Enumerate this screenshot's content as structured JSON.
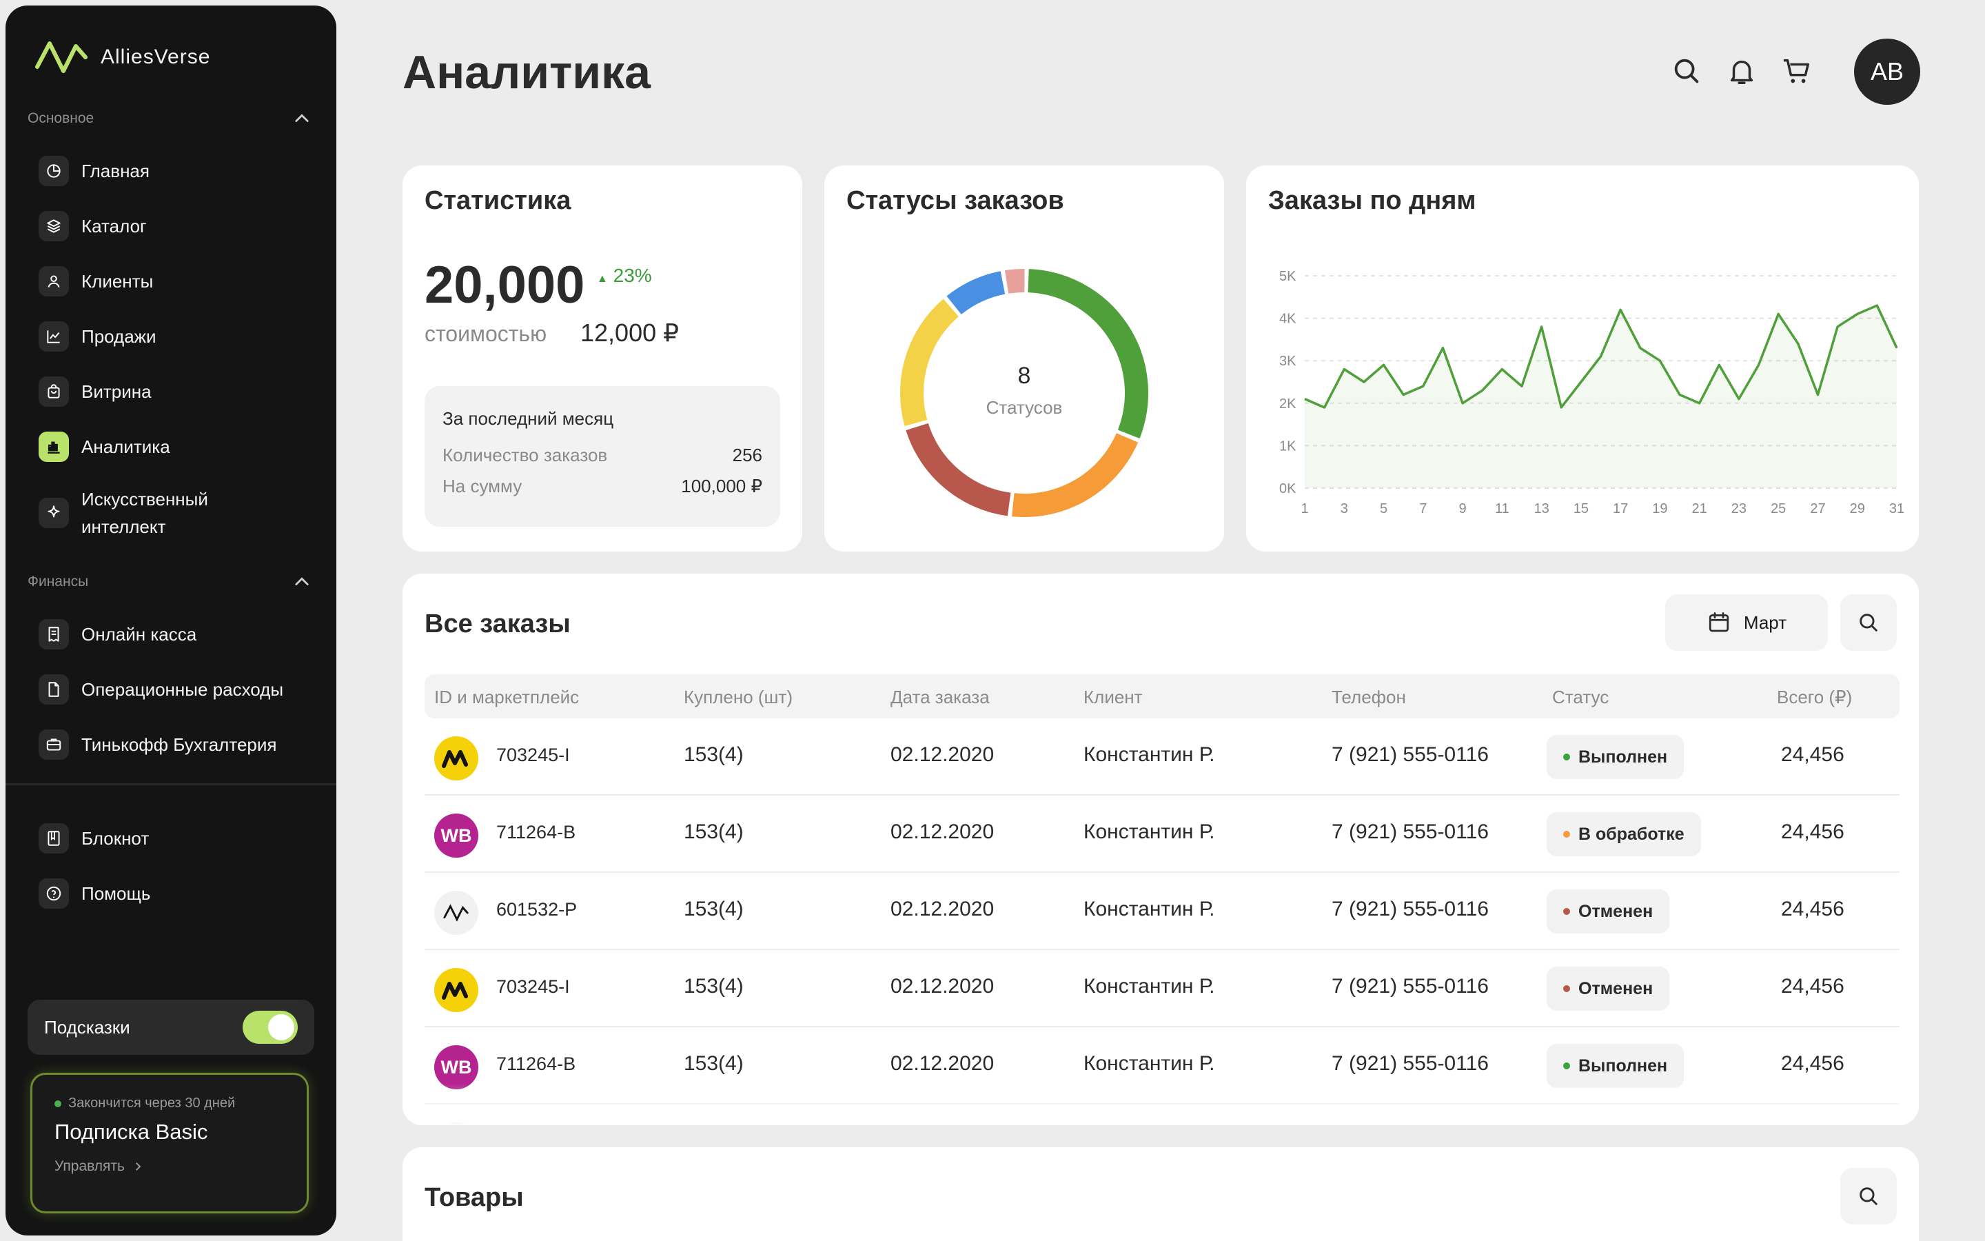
{
  "app": {
    "name": "AlliesVerse"
  },
  "header": {
    "title": "Аналитика",
    "avatar_initials": "AB"
  },
  "sidebar": {
    "section_main": "Основное",
    "section_finance": "Финансы",
    "items_main": [
      {
        "label": "Главная",
        "icon": "chart-pie-icon"
      },
      {
        "label": "Каталог",
        "icon": "layers-icon"
      },
      {
        "label": "Клиенты",
        "icon": "user-icon"
      },
      {
        "label": "Продажи",
        "icon": "line-chart-icon"
      },
      {
        "label": "Витрина",
        "icon": "bag-icon"
      },
      {
        "label": "Аналитика",
        "icon": "bar-chart-icon",
        "active": true
      },
      {
        "label": "Искусственный интеллект",
        "icon": "sparkle-icon"
      }
    ],
    "items_finance": [
      {
        "label": "Онлайн касса",
        "icon": "receipt-icon"
      },
      {
        "label": "Операционные расходы",
        "icon": "document-icon"
      },
      {
        "label": "Тинькофф Бухгалтерия",
        "icon": "briefcase-icon"
      }
    ],
    "items_bottom": [
      {
        "label": "Блокнот",
        "icon": "notebook-icon"
      },
      {
        "label": "Помощь",
        "icon": "help-icon"
      }
    ],
    "tips_label": "Подсказки",
    "tips_on": true,
    "subscription": {
      "note": "Закончится через 30 дней",
      "title": "Подписка Basic",
      "manage": "Управлять"
    }
  },
  "stats": {
    "title": "Статистика",
    "value": "20,000",
    "delta": "23%",
    "cost_label": "стоимостью",
    "cost_value": "12,000 ₽",
    "month_title": "За последний месяц",
    "orders_label": "Количество заказов",
    "orders_value": "256",
    "sum_label": "На сумму",
    "sum_value": "100,000 ₽"
  },
  "statuses": {
    "title": "Статусы заказов",
    "count": "8",
    "count_label": "Статусов",
    "segments": [
      {
        "value": 30,
        "color": "#4f9f3a"
      },
      {
        "value": 20,
        "color": "#f59b38"
      },
      {
        "value": 18,
        "color": "#b8584c"
      },
      {
        "value": 18,
        "color": "#f4d248"
      },
      {
        "value": 8,
        "color": "#4a90e2"
      },
      {
        "value": 3,
        "color": "#e8a09a"
      }
    ]
  },
  "chart_data": {
    "type": "area",
    "title": "Заказы по дням",
    "x": [
      1,
      2,
      3,
      4,
      5,
      6,
      7,
      8,
      9,
      10,
      11,
      12,
      13,
      14,
      15,
      16,
      17,
      18,
      19,
      20,
      21,
      22,
      23,
      24,
      25,
      26,
      27,
      28,
      29,
      30,
      31
    ],
    "x_ticks": [
      "1",
      "3",
      "5",
      "7",
      "9",
      "11",
      "13",
      "15",
      "17",
      "19",
      "21",
      "23",
      "25",
      "27",
      "29",
      "31"
    ],
    "y_ticks": [
      "0K",
      "1K",
      "2K",
      "3K",
      "4K",
      "5K"
    ],
    "ylim": [
      0,
      5000
    ],
    "series": [
      {
        "values": [
          2100,
          1900,
          2800,
          2500,
          2900,
          2200,
          2400,
          3300,
          2000,
          2300,
          2800,
          2400,
          3800,
          1900,
          2500,
          3100,
          4200,
          3300,
          3000,
          2200,
          2000,
          2900,
          2100,
          2900,
          4100,
          3400,
          2200,
          3800,
          4100,
          4300,
          3300
        ],
        "color": "#4f9f3a"
      }
    ],
    "grid": true
  },
  "orders": {
    "title": "Все заказы",
    "month_button": "Март",
    "columns": [
      "ID и маркетплейс",
      "Куплено (шт)",
      "Дата заказа",
      "Клиент",
      "Телефон",
      "Статус",
      "Всего (₽)"
    ],
    "rows": [
      {
        "id": "703245-I",
        "mk": "ym",
        "mk_label": "",
        "qty": "153(4)",
        "date": "02.12.2020",
        "client": "Константин Р.",
        "phone": "7 (921) 555-0116",
        "status": "Выполнен",
        "status_color": "#3aa33a",
        "total": "24,456"
      },
      {
        "id": "711264-B",
        "mk": "wb",
        "mk_label": "WB",
        "qty": "153(4)",
        "date": "02.12.2020",
        "client": "Константин Р.",
        "phone": "7 (921) 555-0116",
        "status": "В обработке",
        "status_color": "#f59b38",
        "total": "24,456"
      },
      {
        "id": "601532-P",
        "mk": "av",
        "mk_label": "",
        "qty": "153(4)",
        "date": "02.12.2020",
        "client": "Константин Р.",
        "phone": "7 (921) 555-0116",
        "status": "Отменен",
        "status_color": "#b8584c",
        "total": "24,456"
      },
      {
        "id": "703245-I",
        "mk": "ym",
        "mk_label": "",
        "qty": "153(4)",
        "date": "02.12.2020",
        "client": "Константин Р.",
        "phone": "7 (921) 555-0116",
        "status": "Отменен",
        "status_color": "#b8584c",
        "total": "24,456"
      },
      {
        "id": "711264-B",
        "mk": "wb",
        "mk_label": "WB",
        "qty": "153(4)",
        "date": "02.12.2020",
        "client": "Константин Р.",
        "phone": "7 (921) 555-0116",
        "status": "Выполнен",
        "status_color": "#3aa33a",
        "total": "24,456"
      }
    ]
  },
  "products": {
    "title": "Товары"
  },
  "colors": {
    "accent": "#b9e26a",
    "sidebar_bg": "#141414",
    "chart_line": "#4f9f3a"
  }
}
